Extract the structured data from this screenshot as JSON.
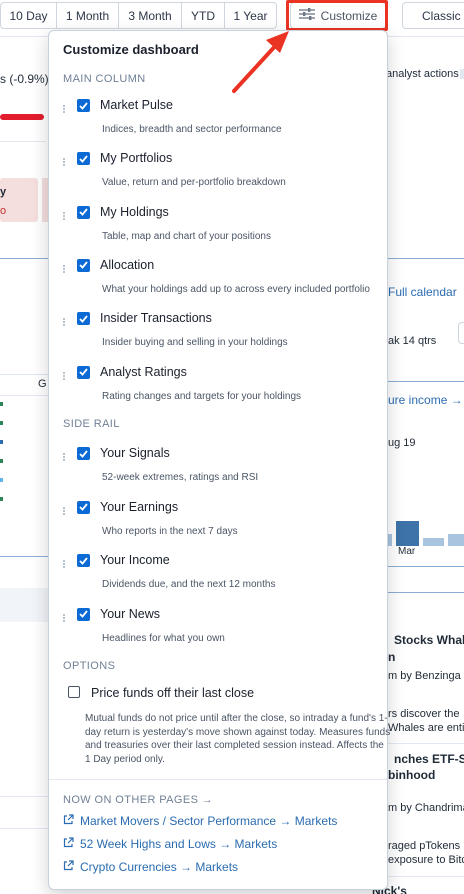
{
  "toolbar": {
    "ranges": [
      "10 Day",
      "1 Month",
      "3 Month",
      "YTD",
      "1 Year"
    ],
    "customize_label": "Customize",
    "classic_label": "Classic"
  },
  "background": {
    "pct_change": "s (-0.9%)",
    "analyst_actions": "analyst actions",
    "full_calendar": "Full calendar",
    "beat": "ak 14 qtrs",
    "future_income": "ure income →",
    "aug": "ug 19",
    "month_label": "Mar",
    "news1_title": "Stocks Whale",
    "news1_title2": "n",
    "news1_src": "m by Benzinga",
    "news1_body": "rs discover the",
    "news1_body2": "Whales are entit",
    "news2_title": "nches ETF-St",
    "news2_title2": "binhood",
    "news2_src": "m by Chandrima",
    "news2_body": "raged pTokens",
    "news2_body2": "exposure to Bitc",
    "left_y": "y",
    "left_o": "o",
    "left_g": "G",
    "bottom_cut": "Nick's"
  },
  "panel": {
    "title": "Customize dashboard",
    "main_column_heading": "MAIN COLUMN",
    "main_items": [
      {
        "label": "Market Pulse",
        "desc": "Indices, breadth and sector performance"
      },
      {
        "label": "My Portfolios",
        "desc": "Value, return and per-portfolio breakdown"
      },
      {
        "label": "My Holdings",
        "desc": "Table, map and chart of your positions"
      },
      {
        "label": "Allocation",
        "desc": "What your holdings add up to across every included portfolio"
      },
      {
        "label": "Insider Transactions",
        "desc": "Insider buying and selling in your holdings"
      },
      {
        "label": "Analyst Ratings",
        "desc": "Rating changes and targets for your holdings"
      }
    ],
    "side_rail_heading": "SIDE RAIL",
    "side_items": [
      {
        "label": "Your Signals",
        "desc": "52-week extremes, ratings and RSI"
      },
      {
        "label": "Your Earnings",
        "desc": "Who reports in the next 7 days"
      },
      {
        "label": "Your Income",
        "desc": "Dividends due, and the next 12 months"
      },
      {
        "label": "Your News",
        "desc": "Headlines for what you own"
      }
    ],
    "options_heading": "OPTIONS",
    "price_funds_label": "Price funds off their last close",
    "price_funds_checked": false,
    "price_funds_note": "Mutual funds do not price until after the close, so intraday a fund's 1-day return is yesterday's move shown against today. Measures funds and treasuries over their last completed session instead. Affects the 1 Day period only.",
    "other_pages_heading": "NOW ON OTHER PAGES →",
    "other_links": [
      "Market Movers / Sector Performance → Markets",
      "52 Week Highs and Lows → Markets",
      "Crypto Currencies → Markets"
    ]
  },
  "colors": {
    "checkbox": "#0b6ad3",
    "highlight": "#ea3323",
    "link": "#2b6cb0"
  }
}
